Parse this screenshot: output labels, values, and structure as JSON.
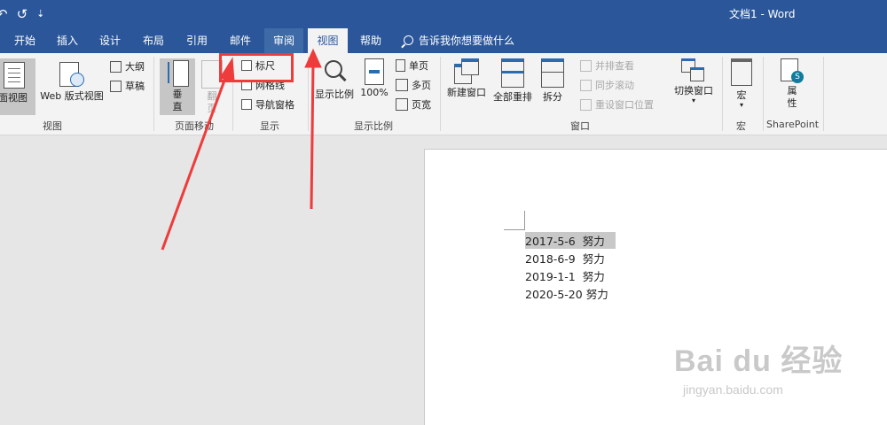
{
  "window": {
    "title": "文档1 - Word",
    "qat_undo": "↶",
    "qat_redo": "↺",
    "qat_more": "⇣"
  },
  "tabs": [
    "开始",
    "插入",
    "设计",
    "布局",
    "引用",
    "邮件",
    "审阅",
    "视图",
    "帮助"
  ],
  "active_tab": "视图",
  "tell_me": "告诉我你想要做什么",
  "ribbon": {
    "views": {
      "print_layout": "页面视图",
      "web_layout": "Web 版式视图",
      "outline": "大纲",
      "draft": "草稿",
      "label": "视图"
    },
    "page_movement": {
      "vertical": "垂直",
      "side_by_side": "翻页",
      "label": "页面移动"
    },
    "show": {
      "ruler": "标尺",
      "gridlines": "网格线",
      "nav_pane": "导航窗格",
      "label": "显示"
    },
    "zoom": {
      "zoom": "显示比例",
      "hundred": "100%",
      "one_page": "单页",
      "multi_page": "多页",
      "page_width": "页宽",
      "label": "显示比例"
    },
    "window": {
      "new_window": "新建窗口",
      "arrange_all": "全部重排",
      "split": "拆分",
      "side_by_side": "并排查看",
      "sync_scroll": "同步滚动",
      "reset_pos": "重设窗口位置",
      "switch_windows": "切换窗口",
      "label": "窗口"
    },
    "macros": {
      "macros": "宏",
      "label": "宏"
    },
    "sharepoint": {
      "properties": "属性",
      "label": "SharePoint"
    }
  },
  "document": {
    "lines": [
      {
        "date": "2017-5-6",
        "text": "努力"
      },
      {
        "date": "2018-6-9",
        "text": "努力"
      },
      {
        "date": "2019-1-1",
        "text": "努力"
      },
      {
        "date": "2020-5-20",
        "text": "努力"
      }
    ]
  },
  "watermark": {
    "brand": "Bai du 经验",
    "url": "jingyan.baidu.com"
  },
  "annotation_color": "#ee3b3b",
  "accent_color": "#2b579a"
}
